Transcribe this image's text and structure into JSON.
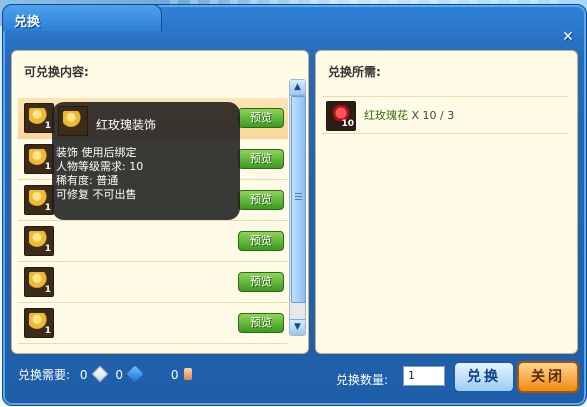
{
  "window": {
    "title": "兑换",
    "close_glyph": "✕"
  },
  "left_panel": {
    "title": "可兑换内容:",
    "items": [
      {
        "qty": "1",
        "preview_label": "预览"
      },
      {
        "qty": "1",
        "preview_label": "预览"
      },
      {
        "qty": "1",
        "preview_label": "预览"
      },
      {
        "qty": "1",
        "preview_label": "预览"
      },
      {
        "qty": "1",
        "preview_label": "预览"
      },
      {
        "qty": "1",
        "preview_label": "预览"
      }
    ]
  },
  "tooltip": {
    "title": "红玫瑰装饰",
    "lines": [
      "装饰  使用后绑定",
      "人物等级需求: 10",
      "稀有度: 普通",
      "可修复 不可出售"
    ]
  },
  "right_panel": {
    "title": "兑换所需:",
    "requirement": {
      "item_name": "红玫瑰花",
      "qty_badge": "10",
      "count_text": "X 10 / 3"
    }
  },
  "bottom": {
    "need_label": "兑换需要:",
    "diamond_value": "0",
    "crystal_value": "0",
    "coupon_value": "0",
    "quantity_label": "兑换数量:",
    "quantity_value": "1",
    "exchange_button": "兑换",
    "close_button": "关闭"
  },
  "colors": {
    "window_blue": "#2468b7",
    "panel_bg": "#fffbe7",
    "preview_green": "#3c9b21",
    "close_orange": "#f08a12"
  }
}
